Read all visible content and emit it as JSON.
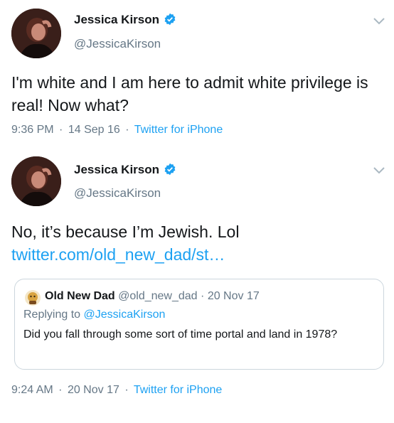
{
  "tweets": [
    {
      "author_name": "Jessica Kirson",
      "author_handle": "@JessicaKirson",
      "text_plain": "I'm white and I am here to admit white privilege is real! Now what?",
      "time": "9:36 PM",
      "date": "14 Sep 16",
      "app": "Twitter for iPhone"
    },
    {
      "author_name": "Jessica Kirson",
      "author_handle": "@JessicaKirson",
      "text_plain": "No, it’s because I’m Jewish. Lol ",
      "text_link": "twitter.com/old_new_dad/st…",
      "time": "9:24 AM",
      "date": "20 Nov 17",
      "app": "Twitter for iPhone",
      "quote": {
        "author_name": "Old New Dad",
        "author_handle": "@old_new_dad",
        "date": "20 Nov 17",
        "replying_prefix": "Replying to ",
        "replying_to": "@JessicaKirson",
        "text": "Did you fall through some sort of time portal and land in 1978?"
      }
    }
  ],
  "separator": "·",
  "icons": {
    "verified": "verified-badge-icon",
    "menu": "chevron-down-icon"
  },
  "colors": {
    "link": "#1da1f2",
    "secondary_text": "#657786",
    "border": "#ccd6dd"
  }
}
